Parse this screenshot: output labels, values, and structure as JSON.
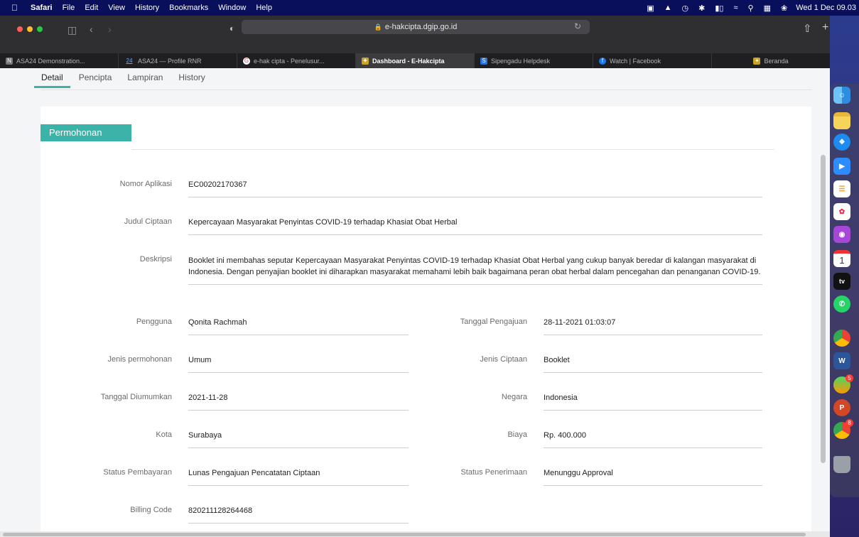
{
  "menubar": {
    "apple": "",
    "items": [
      "Safari",
      "File",
      "Edit",
      "View",
      "History",
      "Bookmarks",
      "Window",
      "Help"
    ],
    "clock": "Wed 1 Dec  09.03"
  },
  "browser": {
    "url": "e-hakcipta.dgip.go.id",
    "tabs": [
      {
        "label": "ASA24 Demonstration...",
        "icon": "N"
      },
      {
        "label": "ASA24 — Profile RNR",
        "icon": "24"
      },
      {
        "label": "e-hak cipta - Penelusur...",
        "icon": "G"
      },
      {
        "label": "Dashboard - E-Hakcipta",
        "icon": "✦"
      },
      {
        "label": "Sipengadu Helpdesk",
        "icon": "S"
      },
      {
        "label": "Watch | Facebook",
        "icon": "f"
      },
      {
        "label": "Beranda",
        "icon": "✦"
      }
    ]
  },
  "subnav": [
    "Detail",
    "Pencipta",
    "Lampiran",
    "History"
  ],
  "section": {
    "title": "Permohonan"
  },
  "fields": {
    "nomor_aplikasi": {
      "label": "Nomor Aplikasi",
      "value": "EC00202170367"
    },
    "judul_ciptaan": {
      "label": "Judul Ciptaan",
      "value": "Kepercayaan Masyarakat Penyintas COVID-19 terhadap Khasiat Obat Herbal"
    },
    "deskripsi": {
      "label": "Deskripsi",
      "value": "Booklet ini membahas seputar Kepercayaan Masyarakat Penyintas COVID-19 terhadap Khasiat Obat Herbal yang cukup banyak beredar di kalangan masyarakat di Indonesia. Dengan penyajian booklet ini diharapkan masyarakat memahami lebih baik bagaimana peran obat herbal dalam pencegahan dan penanganan COVID-19."
    },
    "pengguna": {
      "label": "Pengguna",
      "value": "Qonita Rachmah"
    },
    "tanggal_pengajuan": {
      "label": "Tanggal Pengajuan",
      "value": "28-11-2021 01:03:07"
    },
    "jenis_permohonan": {
      "label": "Jenis permohonan",
      "value": "Umum"
    },
    "jenis_ciptaan": {
      "label": "Jenis Ciptaan",
      "value": "Booklet"
    },
    "tanggal_diumumkan": {
      "label": "Tanggal Diumumkan",
      "value": "2021-11-28"
    },
    "negara": {
      "label": "Negara",
      "value": "Indonesia"
    },
    "kota": {
      "label": "Kota",
      "value": "Surabaya"
    },
    "biaya": {
      "label": "Biaya",
      "value": "Rp. 400.000"
    },
    "status_pembayaran": {
      "label": "Status Pembayaran",
      "value": "Lunas Pengajuan Pencatatan Ciptaan"
    },
    "status_penerimaan": {
      "label": "Status Penerimaan",
      "value": "Menunggu Approval"
    },
    "billing_code": {
      "label": "Billing Code",
      "value": "820211128264468"
    }
  },
  "dock": {
    "calendar_day": "1",
    "tv_label": "tv",
    "word_label": "W",
    "ppt_label": "P",
    "badge_app_store": "5",
    "badge_chrome": "8"
  },
  "colors": {
    "accent": "#3bb3a8",
    "menubar": "#0a0f5c"
  }
}
